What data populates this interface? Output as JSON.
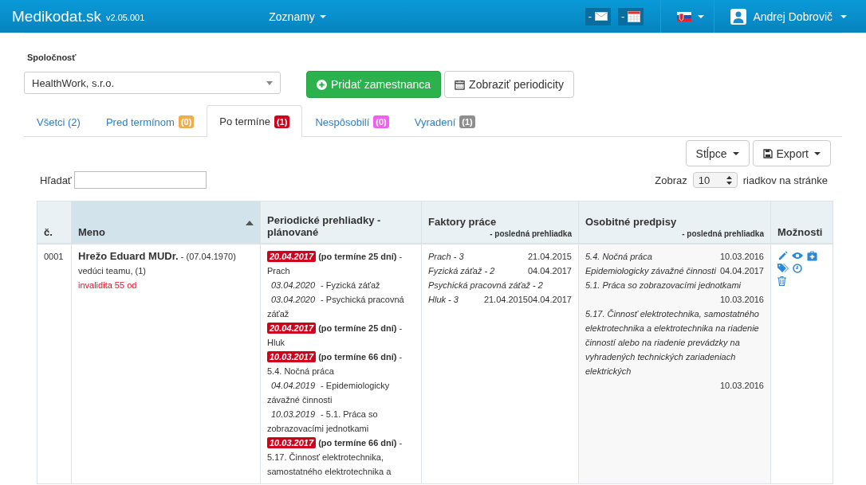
{
  "navbar": {
    "brand": "Medikodat.sk",
    "version": "v2.05.001",
    "menu": "Zoznamy",
    "mail_badge": "-",
    "calendar_badge": "-",
    "user": "Andrej Dobrovič"
  },
  "company": {
    "label": "Spoločnosť",
    "value": "HealthWork, s.r.o."
  },
  "buttons": [
    {
      "kind": "add",
      "label": "Pridať zamestnanca"
    },
    {
      "kind": "calendar",
      "label": "Zobraziť periodicity"
    }
  ],
  "tabs": [
    {
      "label": "Všetci (2)",
      "selected": false
    },
    {
      "label": "Pred termínom",
      "count": "(0)",
      "color": "#f0ad4e",
      "selected": false
    },
    {
      "label": "Po termíne",
      "count": "(1)",
      "color": "#d0021b",
      "selected": true
    },
    {
      "label": "Nespôsobilí",
      "count": "(0)",
      "color": "#f15ff0",
      "selected": false
    },
    {
      "label": "Vyradení",
      "count": "(1)",
      "color": "#8e8e8e",
      "selected": false
    }
  ],
  "toolbar": {
    "columns": "Stĺpce",
    "export": "Export"
  },
  "search": {
    "label": "Hľadať"
  },
  "page_size": {
    "label": "Zobraz",
    "value": "10",
    "suffix": "riadkov na stránke"
  },
  "table": {
    "columns": [
      {
        "label": "č."
      },
      {
        "label": "Meno",
        "sorted": true
      },
      {
        "label": "Periodické prehliadky - plánované"
      },
      {
        "label": "Faktory práce",
        "sub": "- posledná prehliadka"
      },
      {
        "label": "Osobitné predpisy",
        "sub": "- posledná prehliadka"
      },
      {
        "label": "Možnosti"
      }
    ],
    "rows": [
      {
        "number": "0001",
        "name": "Hrežo Eduard MUDr.",
        "birth": "- (07.04.1970)",
        "role": "vedúci teamu, (1)",
        "note": "invalidita 55 od",
        "periodic": [
          {
            "kind": "overdue",
            "date": "20.04.2017",
            "status": "(po termíne 25 dní)",
            "text": "- Prach"
          },
          {
            "kind": "planned",
            "date": "03.04.2020",
            "text": "- Fyzická záťaž"
          },
          {
            "kind": "planned",
            "date": "03.04.2020",
            "text": "- Psychická pracovná záťaž"
          },
          {
            "kind": "overdue",
            "date": "20.04.2017",
            "status": "(po termíne 25 dní)",
            "text": "- Hluk"
          },
          {
            "kind": "overdue",
            "date": "10.03.2017",
            "status": "(po termíne 66 dní)",
            "text": "- 5.4. Nočná práca"
          },
          {
            "kind": "planned",
            "date": "04.04.2019",
            "text": "- Epidemiologicky závažné činnosti"
          },
          {
            "kind": "planned",
            "date": "10.03.2019",
            "text": "- 5.1. Práca so zobrazovacími jednotkami"
          },
          {
            "kind": "overdue",
            "date": "10.03.2017",
            "status": "(po termíne 66 dní)",
            "text": "- 5.17. Činnosť elektrotechnika, samostatného elektrotechnika a"
          }
        ],
        "factors": [
          {
            "name": "Prach - 3",
            "dates": [
              "21.04.2015"
            ]
          },
          {
            "name": "Fyzická záťaž - 2",
            "dates": [
              "04.04.2017"
            ]
          },
          {
            "name": "Psychická pracovná záťaž - 2"
          },
          {
            "name": "Hluk - 3",
            "dates": [
              "21.04.2015",
              "04.04.2017"
            ]
          }
        ],
        "regulations": [
          {
            "name": "5.4. Nočná práca",
            "date": "10.03.2016"
          },
          {
            "name": "Epidemiologicky závažné činnosti",
            "date": "04.04.2017"
          },
          {
            "name": "5.1. Práca so zobrazovacími jednotkami",
            "date": "10.03.2016"
          },
          {
            "name": "5.17. Činnosť elektrotechnika, samostatného elektrotechnika a elektrotechnika na riadenie činností alebo na riadenie prevádzky na vyhradených technických zariadeniach elektrických",
            "date": "10.03.2016"
          }
        ]
      }
    ]
  }
}
